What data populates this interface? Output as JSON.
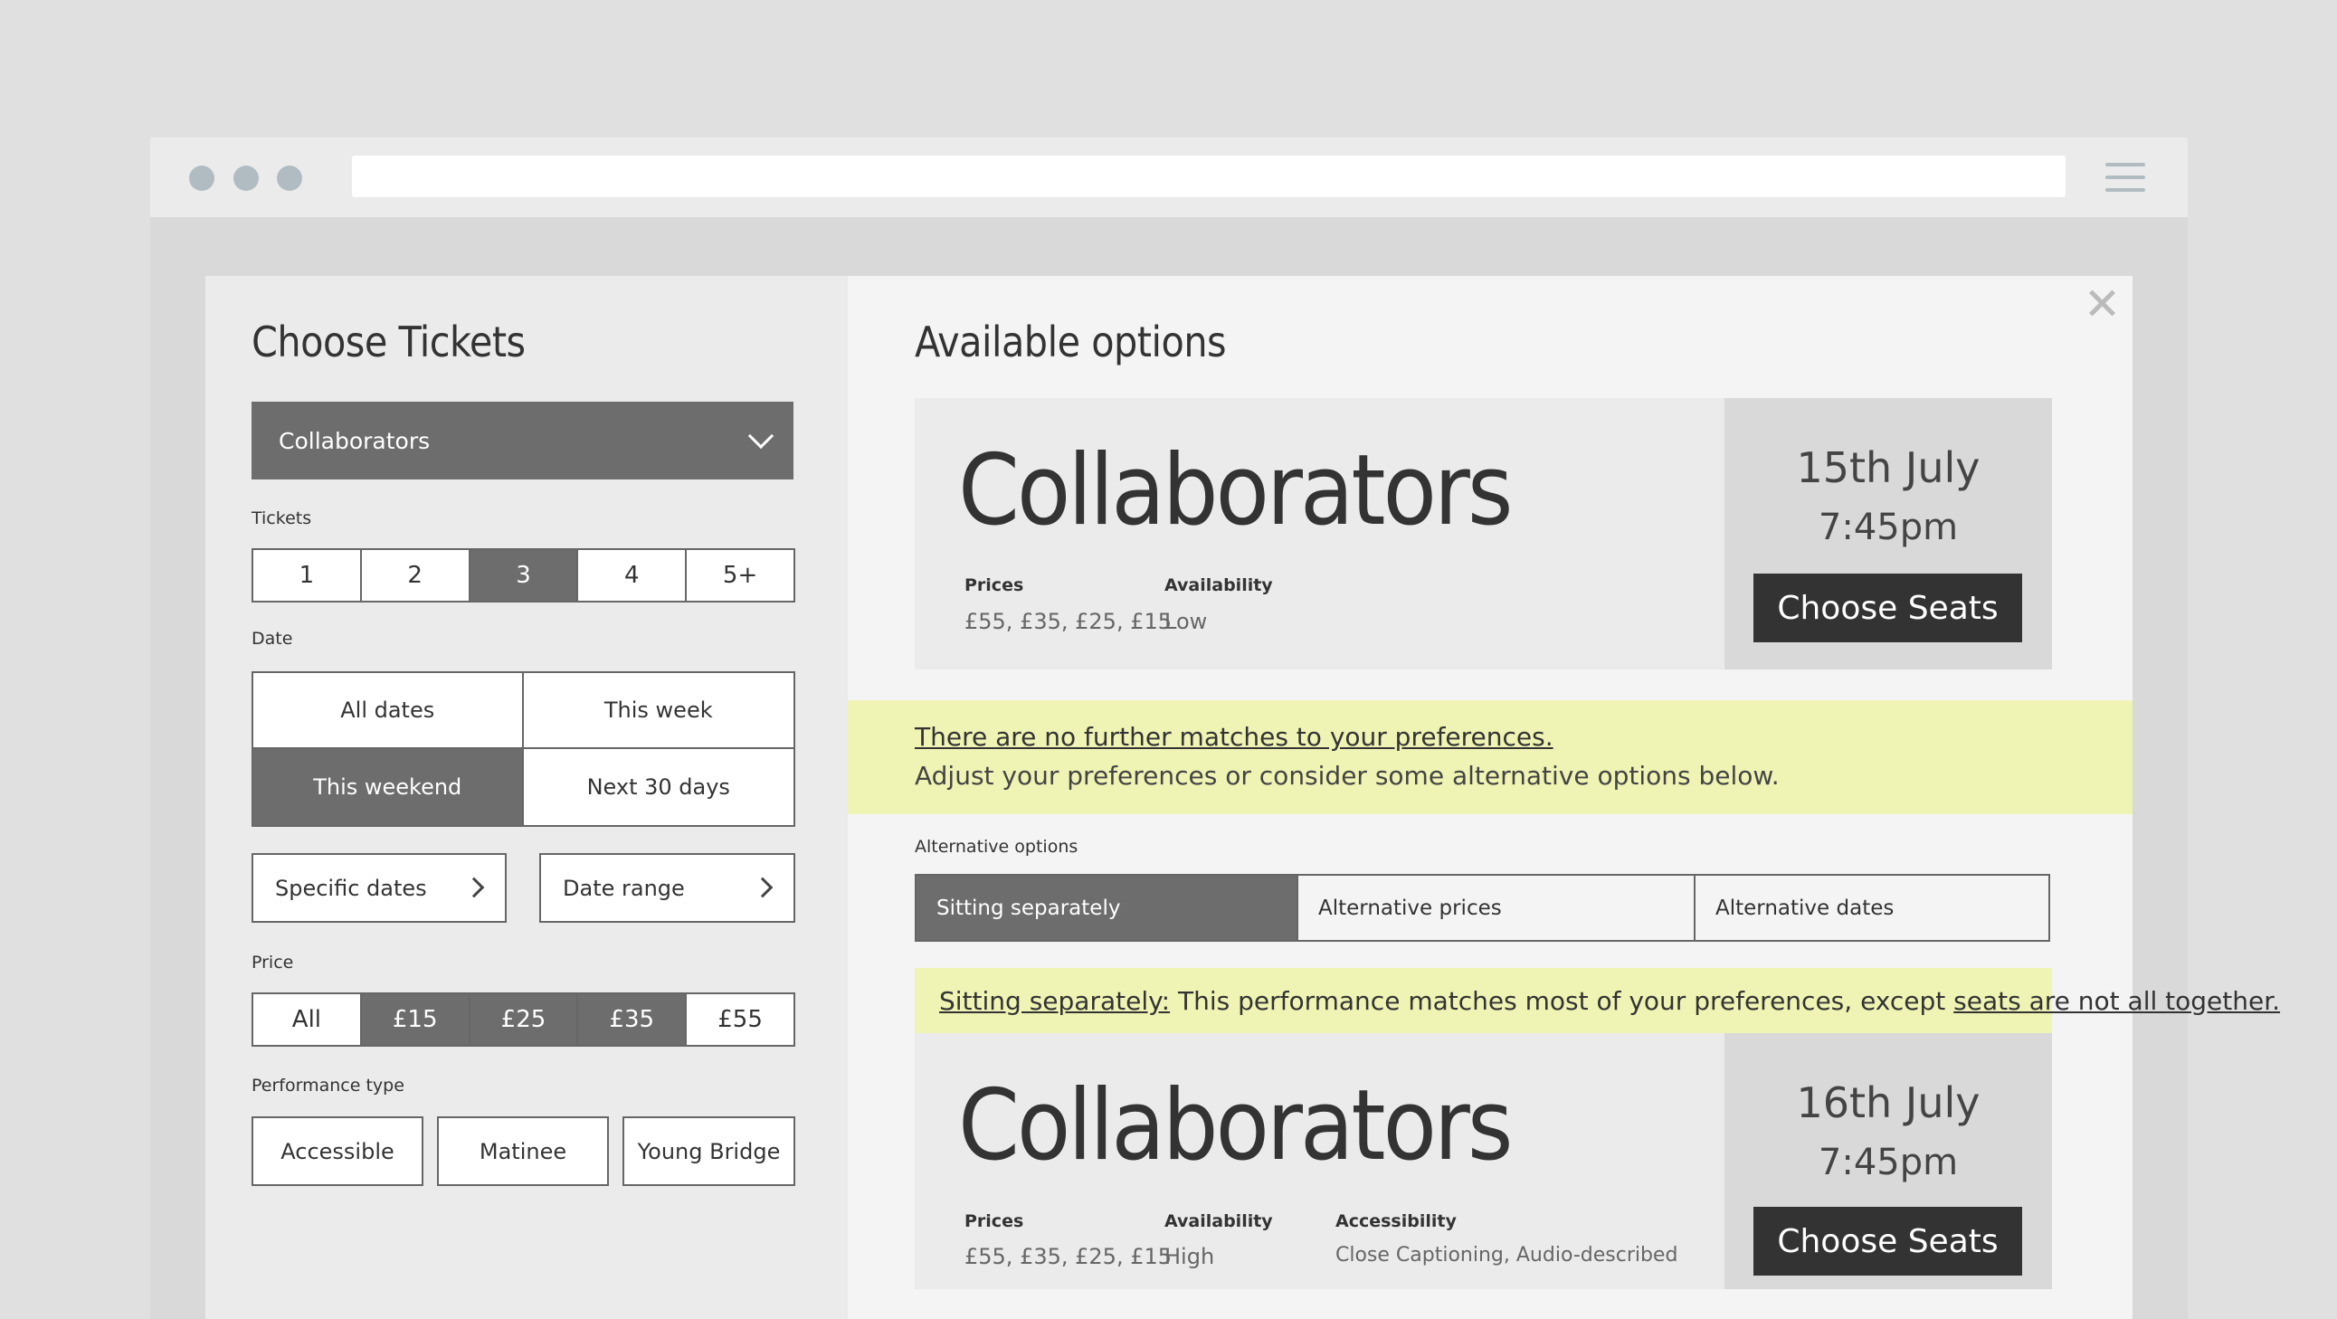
{
  "browser": {
    "url": ""
  },
  "left": {
    "title": "Choose Tickets",
    "show_select": "Collaborators",
    "tickets_label": "Tickets",
    "tickets": [
      "1",
      "2",
      "3",
      "4",
      "5+"
    ],
    "tickets_selected": "3",
    "date_label": "Date",
    "dates": [
      "All dates",
      "This week",
      "This weekend",
      "Next 30 days"
    ],
    "dates_selected": "This weekend",
    "specific_dates": "Specific dates",
    "date_range": "Date range",
    "price_label": "Price",
    "prices": [
      "All",
      "£15",
      "£25",
      "£35",
      "£55"
    ],
    "prices_selected": [
      "£15",
      "£25",
      "£35"
    ],
    "performance_label": "Performance type",
    "performance_types": [
      "Accessible",
      "Matinee",
      "Young Bridge"
    ]
  },
  "right": {
    "title": "Available options",
    "option1": {
      "show": "Collaborators",
      "prices_label": "Prices",
      "prices": "£55, £35, £25, £15",
      "availability_label": "Availability",
      "availability": "Low",
      "date": "15th July",
      "time": "7:45pm",
      "cta": "Choose Seats"
    },
    "notice": {
      "heading": "There are no further matches to your preferences.",
      "body": "Adjust your preferences or consider some alternative options below."
    },
    "alt_label": "Alternative options",
    "alt_tabs": [
      "Sitting separately",
      "Alternative prices",
      "Alternative dates"
    ],
    "alt_selected": "Sitting separately",
    "banner": {
      "lead": "Sitting separately:",
      "middle": " This performance matches most of your preferences, except ",
      "emph": "seats are not all together."
    },
    "option2": {
      "show": "Collaborators",
      "prices_label": "Prices",
      "prices": "£55, £35, £25, £15",
      "availability_label": "Availability",
      "availability": "High",
      "accessibility_label": "Accessibility",
      "accessibility": "Close Captioning, Audio-described",
      "date": "16th July",
      "time": "7:45pm",
      "cta": "Choose Seats"
    }
  },
  "colors": {
    "selected": "#6d6d6d",
    "highlight": "#eff4b4",
    "cta": "#333333",
    "dot": "#b1bcc2"
  }
}
